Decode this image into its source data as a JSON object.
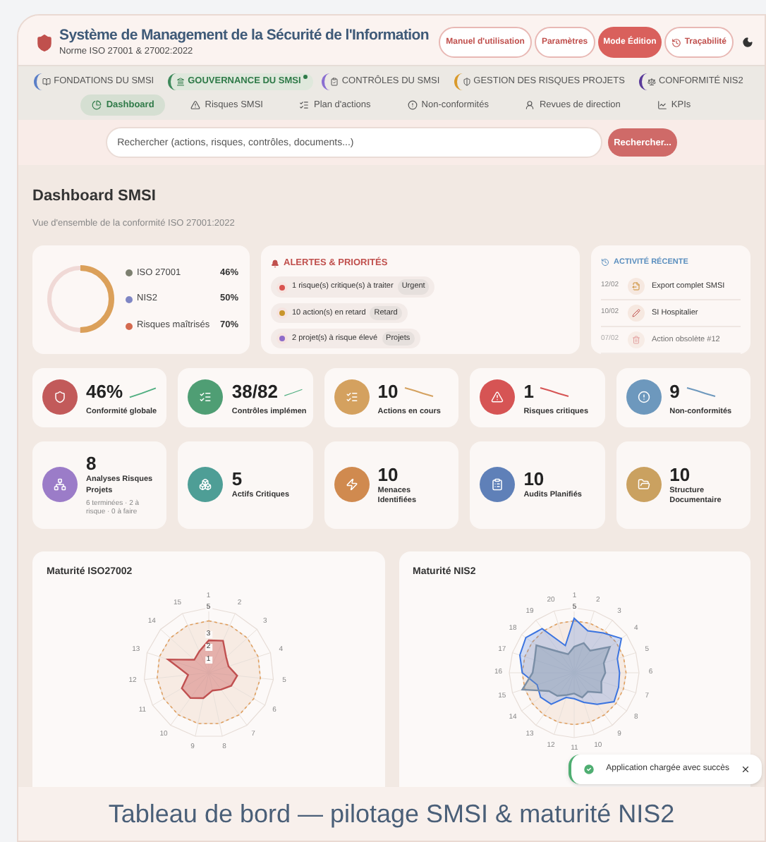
{
  "header": {
    "title": "Système de Management de la Sécurité de l'Information",
    "subtitle": "Norme ISO 27001 & 27002:2022",
    "buttons": [
      {
        "label": "Manuel d'utilisation",
        "kind": "outline"
      },
      {
        "label": "Paramètres",
        "kind": "outline"
      },
      {
        "label": "Mode Édition",
        "kind": "primary"
      },
      {
        "label": "Traçabilité",
        "kind": "history"
      }
    ]
  },
  "modules": [
    {
      "label": "FONDATIONS DU SMSI",
      "selected": false,
      "color": "#5b7fc7"
    },
    {
      "label": "GOUVERNANCE DU SMSI",
      "selected": true,
      "color": "#3f8a5c"
    },
    {
      "label": "CONTRÔLES DU SMSI",
      "selected": false,
      "color": "#8b6fd1"
    },
    {
      "label": "GESTION DES RISQUES PROJETS",
      "selected": false,
      "color": "#d99a2b"
    },
    {
      "label": "CONFORMITÉ NIS2",
      "selected": false,
      "color": "#5a3a9a"
    }
  ],
  "subtabs": [
    {
      "label": "Dashboard",
      "selected": true
    },
    {
      "label": "Risques SMSI",
      "selected": false
    },
    {
      "label": "Plan d'actions",
      "selected": false
    },
    {
      "label": "Non-conformités",
      "selected": false
    },
    {
      "label": "Revues de direction",
      "selected": false
    },
    {
      "label": "KPIs",
      "selected": false
    }
  ],
  "search": {
    "placeholder": "Rechercher (actions, risques, contrôles, documents...)",
    "button": "Rechercher..."
  },
  "page": {
    "title": "Dashboard SMSI",
    "subtitle": "Vue d'ensemble de la conformité ISO 27001:2022"
  },
  "overview": {
    "level": 0.5,
    "items": [
      {
        "label": "ISO 27001",
        "value": "46%",
        "color": "#7d8070"
      },
      {
        "label": "NIS2",
        "value": "50%",
        "color": "#7f86c4"
      },
      {
        "label": "Risques maîtrisés",
        "value": "70%",
        "color": "#d46a4f"
      }
    ]
  },
  "alerts": {
    "title": "ALERTES & PRIORITÉS",
    "items": [
      {
        "text": "1 risque(s) critique(s) à traiter",
        "tag": "Urgent",
        "color": "#d9534f"
      },
      {
        "text": "10 action(s) en retard",
        "tag": "Retard",
        "color": "#c9962c"
      },
      {
        "text": "2 projet(s) à risque élevé",
        "tag": "Projets",
        "color": "#8e6cc9"
      }
    ]
  },
  "activity": {
    "title": "ACTIVITÉ RÉCENTE",
    "items": [
      {
        "date": "12/02",
        "text": "Export complet SMSI",
        "disabled": false
      },
      {
        "date": "10/02",
        "text": "SI Hospitalier",
        "disabled": false
      },
      {
        "date": "07/02",
        "text": "Action obsolète #12",
        "disabled": true
      }
    ]
  },
  "kpis": [
    {
      "value": "46%",
      "label": "Conformité globale",
      "color": "#c25a5a",
      "kind": "up"
    },
    {
      "value": "38/82",
      "label": "Contrôles implémen",
      "color": "#4f9e74",
      "kind": "up"
    },
    {
      "value": "10",
      "label": "Actions en cours",
      "color": "#d4a15f",
      "kind": "down"
    },
    {
      "value": "1",
      "label": "Risques critiques",
      "color": "#d65454",
      "kind": "down"
    },
    {
      "value": "9",
      "label": "Non-conformités",
      "color": "#6d98bd",
      "kind": "down"
    }
  ],
  "stats": [
    {
      "value": "8",
      "label": "Analyses Risques Projets",
      "note": "6 terminées · 2 à risque · 0 à faire",
      "color": "#9b7cc8"
    },
    {
      "value": "5",
      "label": "Actifs Critiques",
      "color": "#4e9e96"
    },
    {
      "value": "10",
      "label": "Menaces Identifiées",
      "color": "#d08a4f"
    },
    {
      "value": "10",
      "label": "Audits Planifiés",
      "color": "#5f80b8"
    },
    {
      "value": "10",
      "label": "Structure Documentaire",
      "color": "#caa160"
    }
  ],
  "charts": [
    {
      "title": "Maturité ISO27002",
      "axes": [
        "1",
        "2",
        "3",
        "4",
        "5",
        "6",
        "7",
        "8",
        "9",
        "10",
        "11",
        "12",
        "13",
        "14",
        "15"
      ],
      "scale_labels": [
        "5",
        "3",
        "2",
        "1"
      ]
    },
    {
      "title": "Maturité NIS2",
      "axes": [
        "1",
        "2",
        "3",
        "4",
        "5",
        "6",
        "7",
        "8",
        "9",
        "10",
        "11",
        "12",
        "13",
        "14",
        "15",
        "16",
        "17",
        "18",
        "19",
        "20"
      ],
      "scale_labels": [
        "5"
      ]
    }
  ],
  "toast": {
    "text": "Application chargée avec succès"
  },
  "caption": "Tableau de bord — pilotage SMSI & maturité NIS2"
}
